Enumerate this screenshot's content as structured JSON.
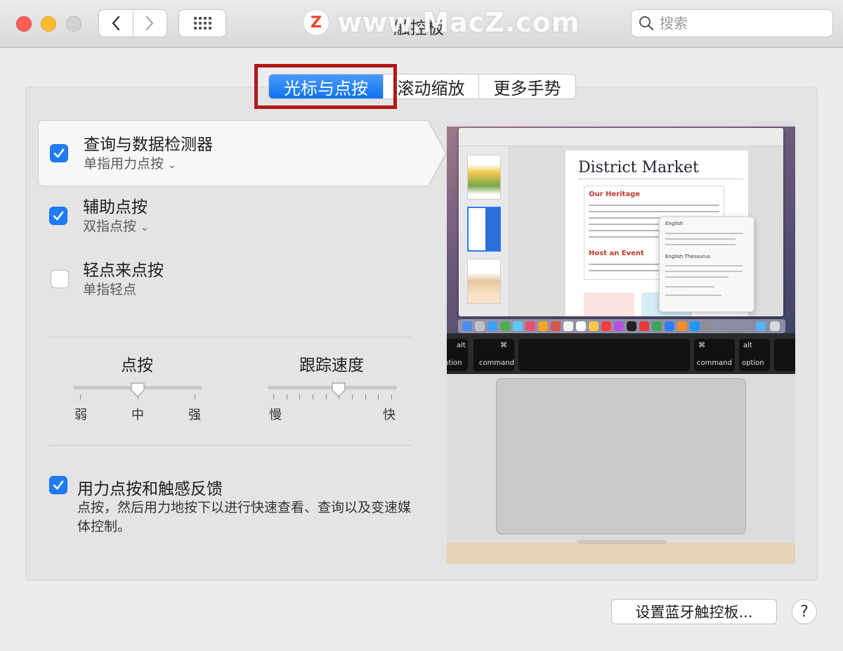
{
  "window": {
    "title": "触控板",
    "watermark_logo": "Z",
    "watermark_text": "www.MacZ.com"
  },
  "search": {
    "placeholder": "搜索",
    "value": ""
  },
  "tabs": [
    {
      "label": "光标与点按",
      "active": true
    },
    {
      "label": "滚动缩放",
      "active": false
    },
    {
      "label": "更多手势",
      "active": false
    }
  ],
  "options": [
    {
      "title": "查询与数据检测器",
      "subtitle": "单指用力点按",
      "checked": true,
      "has_dropdown": true
    },
    {
      "title": "辅助点按",
      "subtitle": "双指点按",
      "checked": true,
      "has_dropdown": true
    },
    {
      "title": "轻点来点按",
      "subtitle": "单指轻点",
      "checked": false,
      "has_dropdown": false
    }
  ],
  "sliders": {
    "click": {
      "title": "点按",
      "labels": [
        "弱",
        "中",
        "强"
      ],
      "value": "中"
    },
    "tracking": {
      "title": "跟踪速度",
      "min_label": "慢",
      "max_label": "快",
      "value_fraction": 0.55
    }
  },
  "force_click": {
    "title": "用力点按和触感反馈",
    "description": "点按，然后用力地按下以进行快速查看、查询以及变速媒体控制。",
    "checked": true
  },
  "preview": {
    "doc_title": "District Market",
    "heading1": "Our Heritage",
    "heading2": "Host an Event",
    "popover_title": "English",
    "popover_thesaurus": "English Thesaurus",
    "key_left_top": "alt",
    "key_left_bottom": "option",
    "key_cmd_symbol": "⌘",
    "key_cmd_label": "command"
  },
  "bottom": {
    "bluetooth_button": "设置蓝牙触控板...",
    "help": "?"
  },
  "colors": {
    "accent": "#1f7cf6",
    "highlight_border": "#b01818"
  }
}
